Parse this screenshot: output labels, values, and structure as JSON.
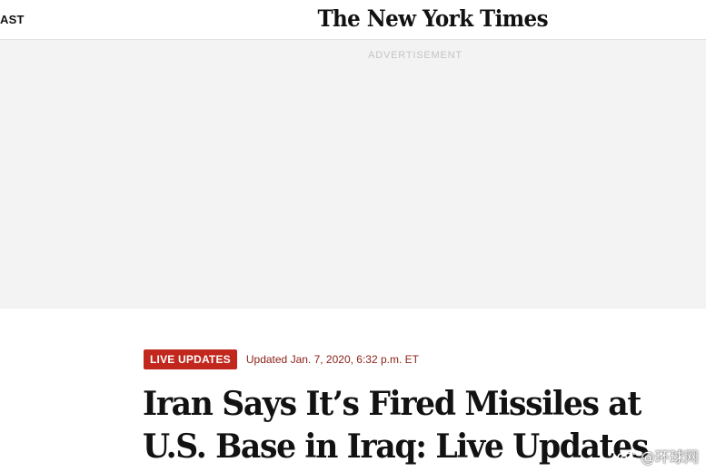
{
  "header": {
    "section_label": "AST",
    "masthead": "The New York Times"
  },
  "ad": {
    "label": "ADVERTISEMENT"
  },
  "article": {
    "badge": "LIVE UPDATES",
    "updated": "Updated Jan. 7, 2020, 6:32 p.m. ET",
    "headline": "Iran Says It’s Fired Missiles at U.S. Base in Iraq: Live Updates"
  },
  "watermark": {
    "text": "@环球网",
    "icon": "weibo-icon"
  },
  "colors": {
    "badge_bg": "#c1271d",
    "updated_text": "#8a1f16",
    "ad_bg": "#f3f3f3"
  }
}
